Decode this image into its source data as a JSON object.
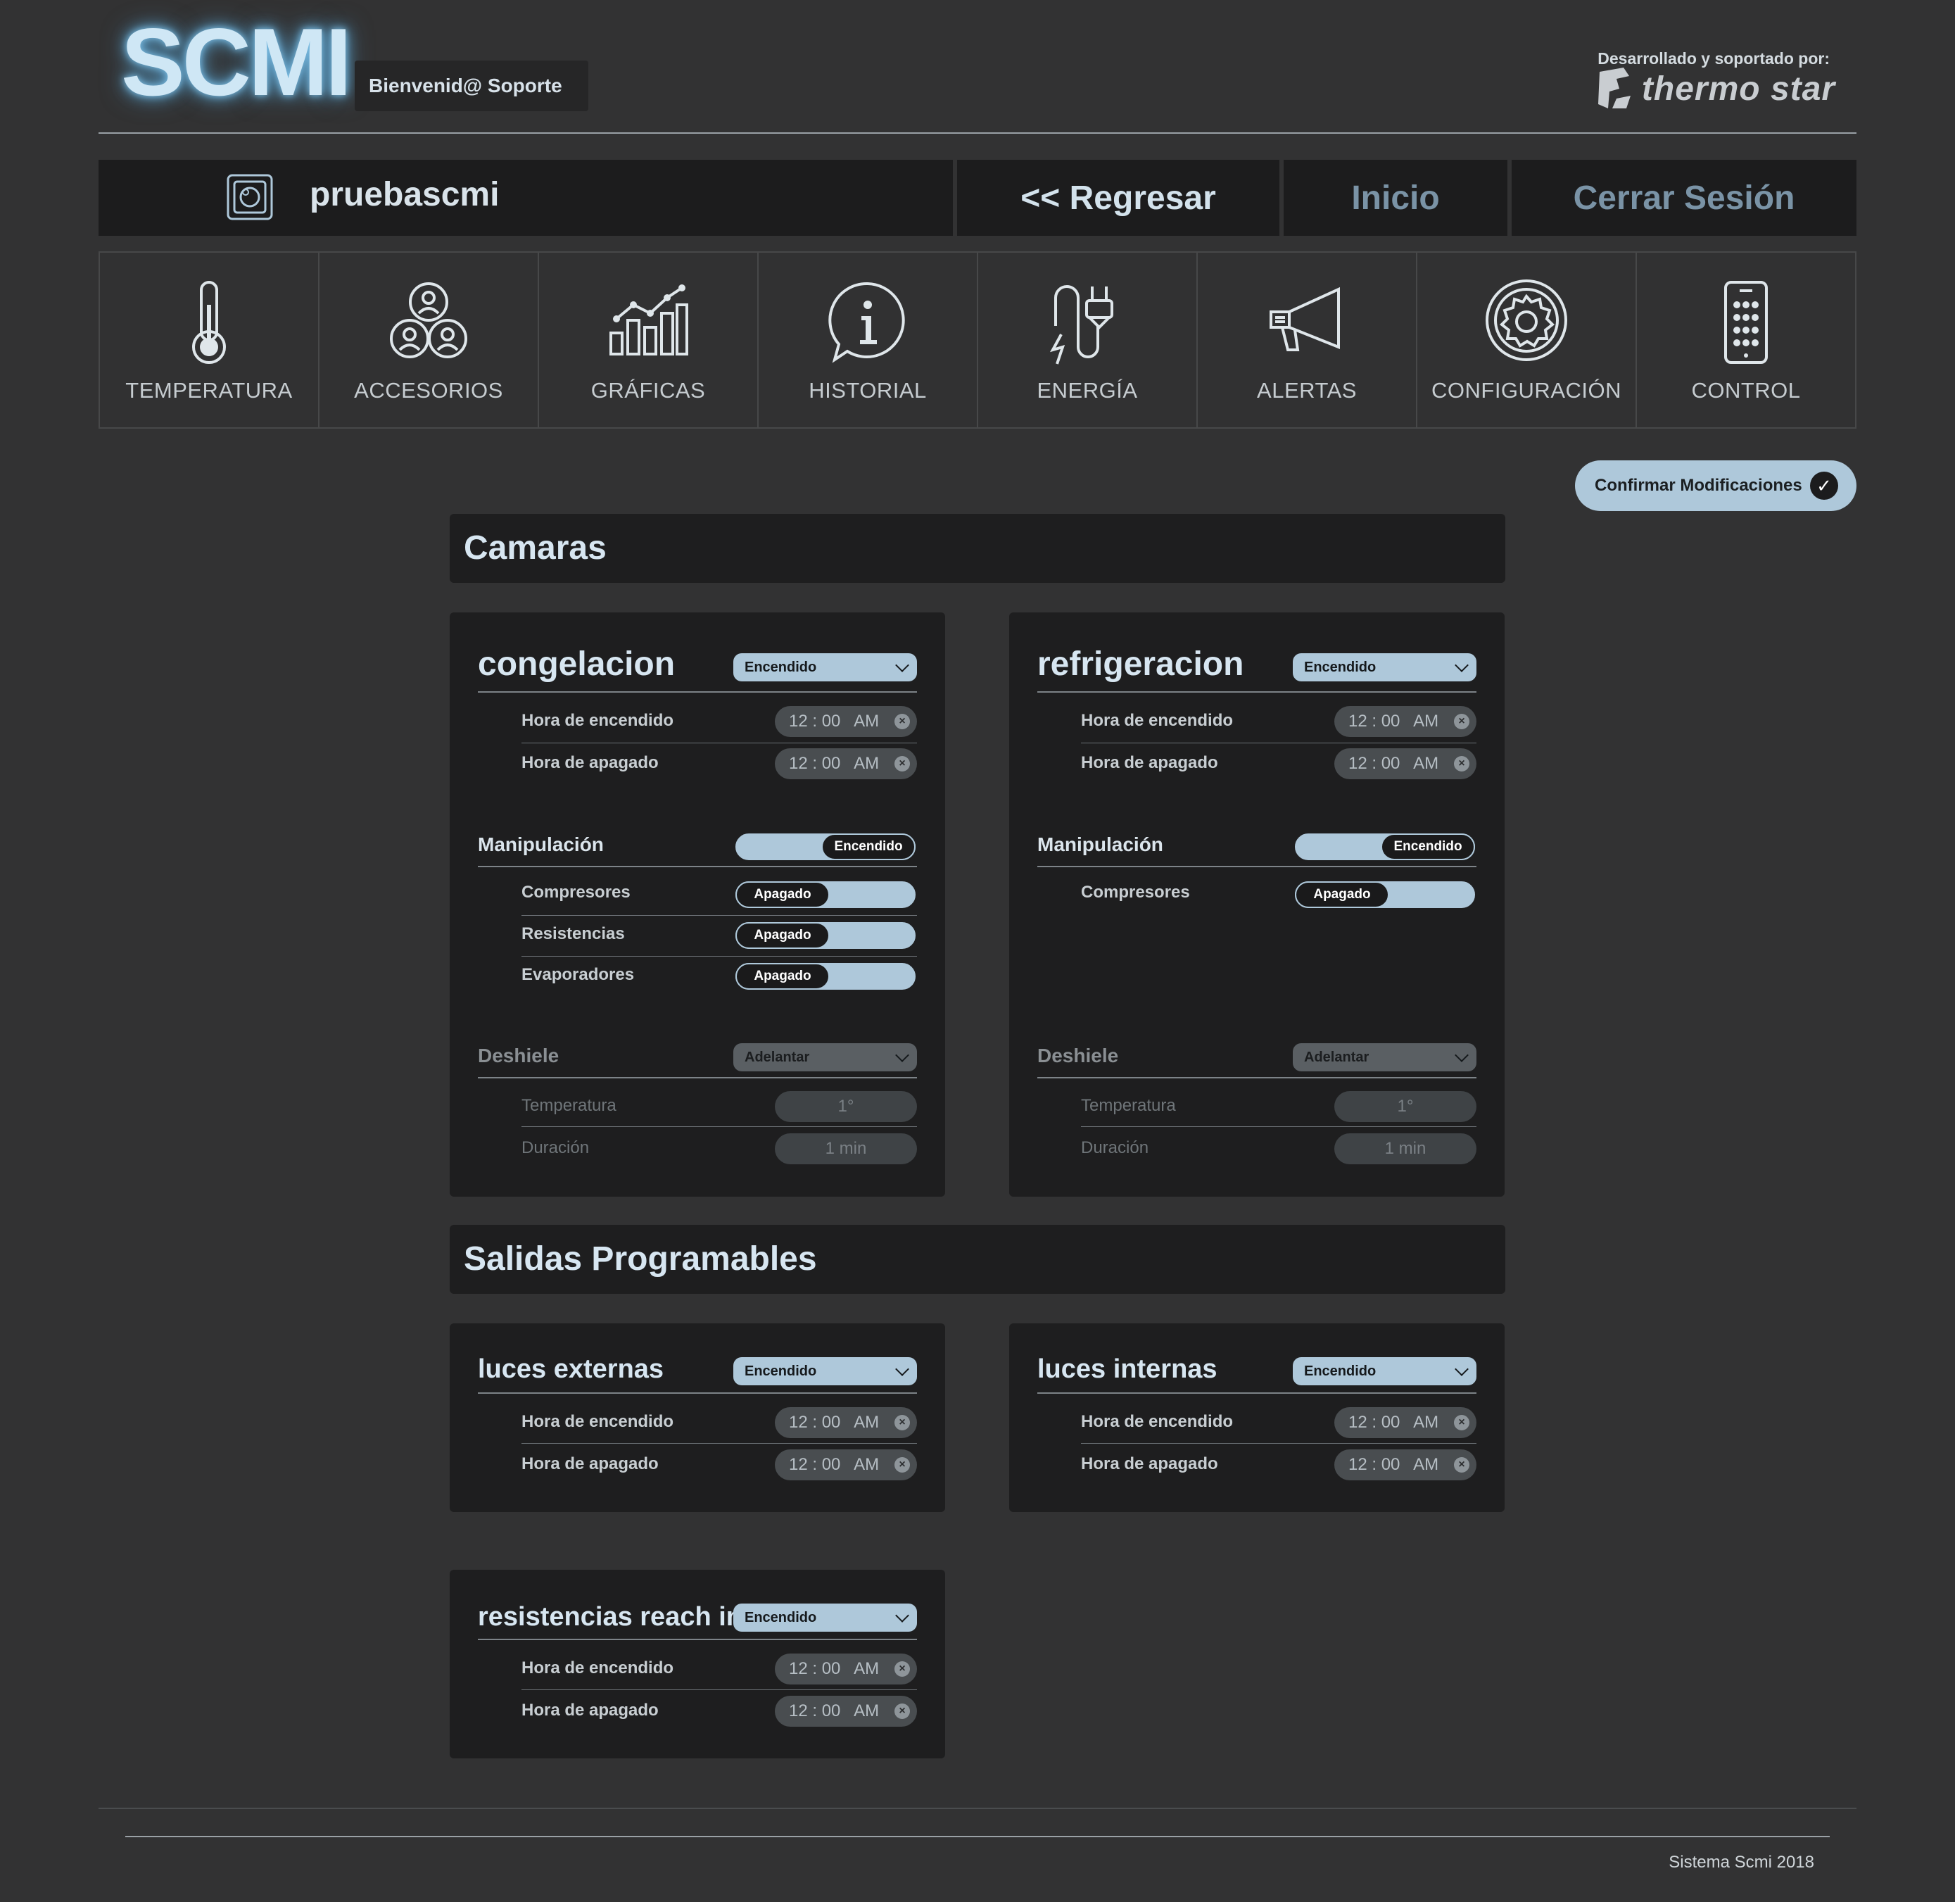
{
  "header": {
    "logo": "SCMI",
    "welcome": "Bienvenid@ Soporte",
    "developed_by": "Desarrollado y soportado por:",
    "brand": "thermo star"
  },
  "topbar": {
    "user": "pruebascmi",
    "back": "<< Regresar",
    "home": "Inicio",
    "logout": "Cerrar Sesión",
    "colors": {
      "back": "#d3e2ec",
      "home": "#7a93a6",
      "logout": "#7a93a6"
    }
  },
  "nav": [
    {
      "label": "TEMPERATURA",
      "icon": "thermometer-icon"
    },
    {
      "label": "ACCESORIOS",
      "icon": "people-group-icon"
    },
    {
      "label": "GRÁFICAS",
      "icon": "bar-chart-icon"
    },
    {
      "label": "HISTORIAL",
      "icon": "info-bubble-icon"
    },
    {
      "label": "ENERGÍA",
      "icon": "power-plug-icon"
    },
    {
      "label": "ALERTAS",
      "icon": "megaphone-icon"
    },
    {
      "label": "CONFIGURACIÓN",
      "icon": "gear-icon"
    },
    {
      "label": "CONTROL",
      "icon": "remote-control-icon"
    }
  ],
  "confirm_label": "Confirmar Modificaciones",
  "camaras": {
    "title": "Camaras",
    "cards": [
      {
        "name": "congelacion",
        "status": "Encendido",
        "on_label": "Hora de encendido",
        "on_time": "12 : 00   AM",
        "off_label": "Hora de apagado",
        "off_time": "12 : 00   AM",
        "manip_label": "Manipulación",
        "manip_state": "Encendido",
        "items": [
          {
            "label": "Compresores",
            "state": "Apagado"
          },
          {
            "label": "Resistencias",
            "state": "Apagado"
          },
          {
            "label": "Evaporadores",
            "state": "Apagado"
          }
        ],
        "defrost_label": "Deshiele",
        "defrost_mode": "Adelantar",
        "temp_label": "Temperatura",
        "temp_value": "1°",
        "dur_label": "Duración",
        "dur_value": "1 min"
      },
      {
        "name": "refrigeracion",
        "status": "Encendido",
        "on_label": "Hora de encendido",
        "on_time": "12 : 00   AM",
        "off_label": "Hora de apagado",
        "off_time": "12 : 00   AM",
        "manip_label": "Manipulación",
        "manip_state": "Encendido",
        "items": [
          {
            "label": "Compresores",
            "state": "Apagado"
          }
        ],
        "defrost_label": "Deshiele",
        "defrost_mode": "Adelantar",
        "temp_label": "Temperatura",
        "temp_value": "1°",
        "dur_label": "Duración",
        "dur_value": "1 min"
      }
    ]
  },
  "salidas": {
    "title": "Salidas Programables",
    "cards": [
      {
        "name": "luces externas",
        "status": "Encendido",
        "on_label": "Hora de encendido",
        "on_time": "12 : 00   AM",
        "off_label": "Hora de apagado",
        "off_time": "12 : 00   AM"
      },
      {
        "name": "luces internas",
        "status": "Encendido",
        "on_label": "Hora de encendido",
        "on_time": "12 : 00   AM",
        "off_label": "Hora de apagado",
        "off_time": "12 : 00   AM"
      },
      {
        "name": "resistencias reach in",
        "status": "Encendido",
        "on_label": "Hora de encendido",
        "on_time": "12 : 00   AM",
        "off_label": "Hora de apagado",
        "off_time": "12 : 00   AM"
      }
    ]
  },
  "footer": "Sistema Scmi 2018",
  "colors": {
    "accent": "#aec8da",
    "background": "#323233",
    "panel": "#1e1e1f"
  }
}
